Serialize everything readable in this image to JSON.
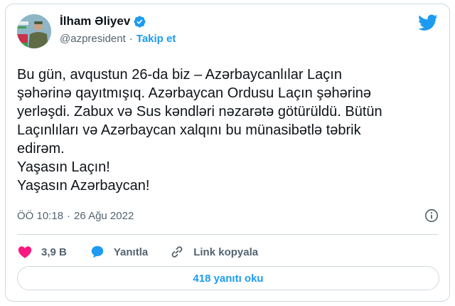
{
  "header": {
    "name": "İlham Əliyev",
    "handle": "@azpresident",
    "separator": "·",
    "follow_label": "Takip et",
    "verified_icon": "verified-badge-icon",
    "logo_icon": "twitter-bird-icon"
  },
  "tweet": {
    "lines": [
      "Bu gün, avqustun 26-da biz – Azərbaycanlılar Laçın",
      "şəhərinə qayıtmışıq. Azərbaycan Ordusu Laçın şəhərinə",
      "yerləşdi. Zabux və Sus kəndləri nəzarətə götürüldü. Bütün",
      "Laçınlıları və Azərbaycan xalqını bu münasibətlə təbrik",
      "edirəm.",
      "Yaşasın Laçın!",
      "Yaşasın Azərbaycan!"
    ],
    "time": "ÖÖ 10:18",
    "time_separator": "·",
    "date": "26 Ağu 2022"
  },
  "actions": {
    "likes": "3,9 B",
    "reply_label": "Yanıtla",
    "copy_link_label": "Link kopyala"
  },
  "replies_button": "418 yanıtı oku",
  "colors": {
    "accent": "#1d9bf0",
    "like": "#f91880",
    "text": "#0f1419",
    "muted": "#536471",
    "border": "#cfd9de"
  }
}
